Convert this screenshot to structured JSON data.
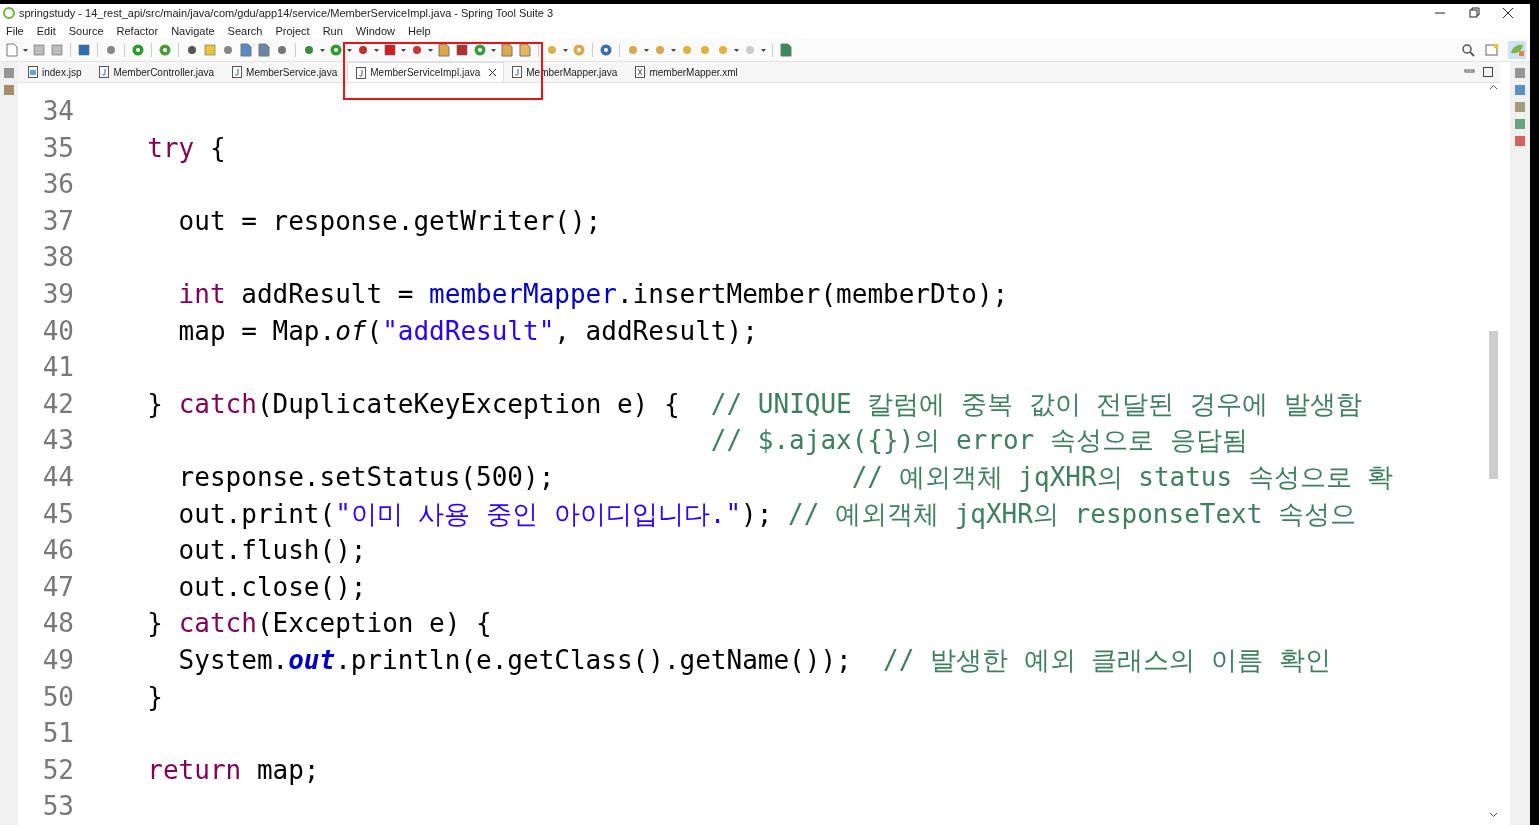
{
  "window": {
    "title": "springstudy - 14_rest_api/src/main/java/com/gdu/app14/service/MemberServiceImpl.java - Spring Tool Suite 3"
  },
  "menu": [
    "File",
    "Edit",
    "Source",
    "Refactor",
    "Navigate",
    "Search",
    "Project",
    "Run",
    "Window",
    "Help"
  ],
  "tabs": [
    {
      "label": "index.jsp",
      "kind": "jsp",
      "selected": false
    },
    {
      "label": "MemberController.java",
      "kind": "java",
      "selected": false
    },
    {
      "label": "MemberService.java",
      "kind": "java",
      "selected": false
    },
    {
      "label": "MemberServiceImpl.java",
      "kind": "java",
      "selected": true
    },
    {
      "label": "MemberMapper.java",
      "kind": "java",
      "selected": false
    },
    {
      "label": "memberMapper.xml",
      "kind": "xml",
      "selected": false
    }
  ],
  "editor": {
    "lines": [
      {
        "number": "34"
      },
      {
        "number": "35",
        "tokens": [
          {
            "kind": "keyword",
            "text": "  try"
          },
          {
            "kind": "plain",
            "text": " {"
          }
        ]
      },
      {
        "number": "36"
      },
      {
        "number": "37",
        "tokens": [
          {
            "kind": "plain",
            "text": "    out = response.getWriter();"
          }
        ]
      },
      {
        "number": "38"
      },
      {
        "number": "39",
        "tokens": [
          {
            "kind": "keyword",
            "text": "    int"
          },
          {
            "kind": "plain",
            "text": " addResult = "
          },
          {
            "kind": "field",
            "text": "memberMapper"
          },
          {
            "kind": "plain",
            "text": ".insertMember(memberDto);"
          }
        ]
      },
      {
        "number": "40",
        "tokens": [
          {
            "kind": "plain",
            "text": "    map = Map."
          },
          {
            "kind": "static",
            "text": "of"
          },
          {
            "kind": "plain",
            "text": "("
          },
          {
            "kind": "string",
            "text": "\"addResult\""
          },
          {
            "kind": "plain",
            "text": ", addResult);"
          }
        ]
      },
      {
        "number": "41"
      },
      {
        "number": "42",
        "tokens": [
          {
            "kind": "plain",
            "text": "  } "
          },
          {
            "kind": "keyword",
            "text": "catch"
          },
          {
            "kind": "plain",
            "text": "(DuplicateKeyException e) {  "
          },
          {
            "kind": "comment",
            "text": "// UNIQUE 칼럼에 중복 값이 전달된 경우에 발생함"
          }
        ]
      },
      {
        "number": "43",
        "tokens": [
          {
            "kind": "comment",
            "text": "                                      // $.ajax({})의 error 속성으로 응답됨"
          }
        ]
      },
      {
        "number": "44",
        "tokens": [
          {
            "kind": "plain",
            "text": "    response.setStatus(500);                   "
          },
          {
            "kind": "comment",
            "text": "// 예외객체 jqXHR의 status 속성으로 확"
          }
        ]
      },
      {
        "number": "45",
        "tokens": [
          {
            "kind": "plain",
            "text": "    out.print("
          },
          {
            "kind": "string",
            "text": "\"이미 사용 중인 아이디입니다.\""
          },
          {
            "kind": "plain",
            "text": "); "
          },
          {
            "kind": "comment",
            "text": "// 예외객체 jqXHR의 responseText 속성으"
          }
        ]
      },
      {
        "number": "46",
        "tokens": [
          {
            "kind": "plain",
            "text": "    out.flush();"
          }
        ]
      },
      {
        "number": "47",
        "tokens": [
          {
            "kind": "plain",
            "text": "    out.close();"
          }
        ]
      },
      {
        "number": "48",
        "tokens": [
          {
            "kind": "plain",
            "text": "  } "
          },
          {
            "kind": "keyword",
            "text": "catch"
          },
          {
            "kind": "plain",
            "text": "(Exception e) {"
          }
        ]
      },
      {
        "number": "49",
        "tokens": [
          {
            "kind": "plain",
            "text": "    System."
          },
          {
            "kind": "staticfield",
            "text": "out"
          },
          {
            "kind": "plain",
            "text": ".println(e.getClass().getName());  "
          },
          {
            "kind": "comment",
            "text": "// 발생한 예외 클래스의 이름 확인"
          }
        ]
      },
      {
        "number": "50",
        "tokens": [
          {
            "kind": "plain",
            "text": "  }"
          }
        ]
      },
      {
        "number": "51"
      },
      {
        "number": "52",
        "tokens": [
          {
            "kind": "keyword",
            "text": "  return"
          },
          {
            "kind": "plain",
            "text": " map;"
          }
        ]
      },
      {
        "number": "53"
      }
    ]
  }
}
